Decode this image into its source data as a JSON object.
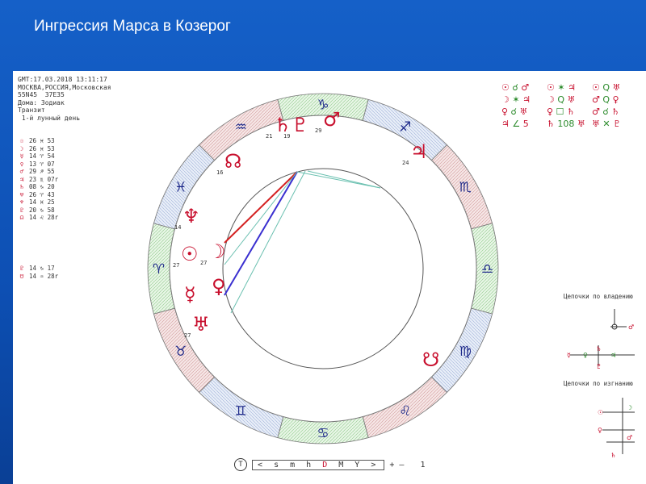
{
  "slide": {
    "title": "Ингрессия Марса в Козерог"
  },
  "info": {
    "lines": [
      "GMT:17.03.2018 13:11:17",
      "МОСКВА,РОССИЯ,Московская",
      "55N45  37E35",
      "Дома: Зодиак",
      "Транзит",
      " 1-й лунный день"
    ]
  },
  "planets": [
    {
      "glyph": "☉",
      "text": "26 ♓ 53"
    },
    {
      "glyph": "☽",
      "text": "26 ♓ 53"
    },
    {
      "glyph": "☿",
      "text": "14 ♈ 54"
    },
    {
      "glyph": "♀",
      "text": "13 ♈ 07"
    },
    {
      "glyph": "♂",
      "text": "29 ♐ 55"
    },
    {
      "glyph": "♃",
      "text": "23 ♏ 07r"
    },
    {
      "glyph": "♄",
      "text": "08 ♑ 20"
    },
    {
      "glyph": "♅",
      "text": "26 ♈ 43"
    },
    {
      "glyph": "♆",
      "text": "14 ♓ 25"
    },
    {
      "glyph": "♇",
      "text": "20 ♑ 58"
    },
    {
      "glyph": "☊",
      "text": "14 ♌ 28r"
    }
  ],
  "planets2": [
    {
      "glyph": "♇",
      "text": "14 ♑ 17"
    },
    {
      "glyph": "☋",
      "text": "14 ♒ 28r"
    }
  ],
  "grid": [
    {
      "a": "☉",
      "b": "☌",
      "c": "♂"
    },
    {
      "a": "☉",
      "b": "✶",
      "c": "♃"
    },
    {
      "a": "☉",
      "b": "Q",
      "c": "♅"
    },
    {
      "a": "☽",
      "b": "✶",
      "c": "♃"
    },
    {
      "a": "☽",
      "b": "Q",
      "c": "♅"
    },
    {
      "a": "♂",
      "b": "Q",
      "c": "♀"
    },
    {
      "a": "♀",
      "b": "☌",
      "c": "♅"
    },
    {
      "a": "♀",
      "b": "☐",
      "c": "♄"
    },
    {
      "a": "♂",
      "b": "☌",
      "c": "♄"
    },
    {
      "a": "♃",
      "b": "∠",
      "c": "5"
    },
    {
      "a": "♄",
      "b": "108",
      "c": "♅"
    },
    {
      "a": "♅",
      "b": "✕",
      "c": "♇"
    }
  ],
  "chart": {
    "signs_outer": [
      "♑",
      "♐",
      "♏",
      "♎",
      "♍",
      "♌",
      "♋",
      "♊",
      "♉",
      "♈",
      "♓",
      "♒"
    ],
    "planet_labels": [
      {
        "glyph": "♄",
        "deg": "21"
      },
      {
        "glyph": "♇",
        "deg": "19"
      },
      {
        "glyph": "♃",
        "deg": "24"
      },
      {
        "glyph": "☊",
        "deg": "16"
      },
      {
        "glyph": "♆",
        "deg": "14"
      },
      {
        "glyph": "☉",
        "deg": "27"
      },
      {
        "glyph": "☽",
        "deg": "27"
      },
      {
        "glyph": "☿",
        "deg": ""
      },
      {
        "glyph": "♀",
        "deg": ""
      },
      {
        "glyph": "♅",
        "deg": "27"
      },
      {
        "glyph": "☋",
        "deg": ""
      },
      {
        "glyph": "♂",
        "deg": "29"
      }
    ]
  },
  "chains": {
    "label1": "Цепочки по владению",
    "label2": "Цепочки по изгнанию"
  },
  "toolbar": {
    "circle": "T",
    "left": "<",
    "scale": "s m h",
    "scale_sel": "D",
    "scale_rest": "M Y",
    "right": ">",
    "plus": "+",
    "minus": "—",
    "step": "1"
  },
  "colors": {
    "accent": "#c8102e",
    "green": "#2a8a2a",
    "blue_line": "#3a2fd0",
    "red_line": "#d42020"
  }
}
